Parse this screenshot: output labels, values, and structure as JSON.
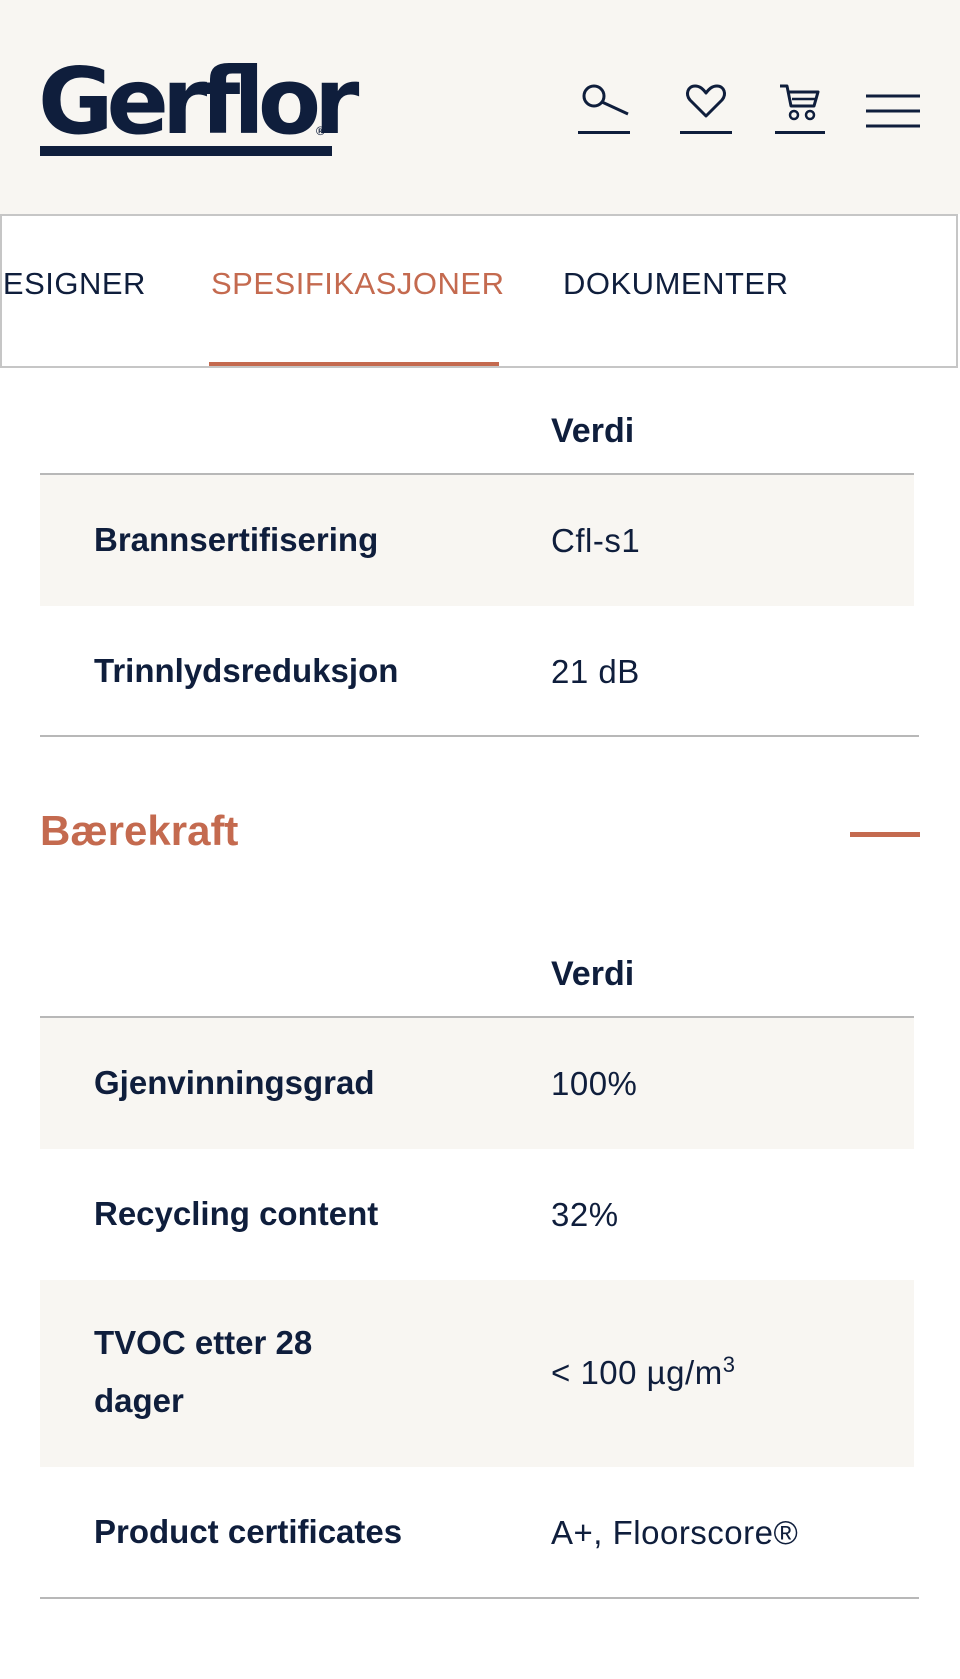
{
  "header": {
    "logo_text": "Gerflor",
    "logo_reg": "®",
    "icons": [
      "search-icon",
      "heart-icon",
      "cart-icon",
      "menu-icon"
    ]
  },
  "tabs": [
    {
      "label": "DESIGNER"
    },
    {
      "label": "SPESIFIKASJONER",
      "active": true
    },
    {
      "label": "DOKUMENTER"
    }
  ],
  "table1": {
    "header": "Verdi",
    "rows": [
      {
        "label": "Brannsertifisering",
        "value": "Cfl-s1"
      },
      {
        "label": "Trinnlydsreduksjon",
        "value": "21 dB"
      }
    ]
  },
  "section": {
    "title": "Bærekraft",
    "state": "expanded"
  },
  "table2": {
    "header": "Verdi",
    "rows": [
      {
        "label": "Gjenvinningsgrad",
        "value": "100%"
      },
      {
        "label": "Recycling content",
        "value": "32%"
      },
      {
        "label": "TVOC etter 28 dager",
        "value": "< 100 µg/m",
        "value_sup": "3"
      },
      {
        "label": "Product certificates",
        "value": "A+, Floorscore®"
      }
    ]
  },
  "colors": {
    "navy": "#0f1e3c",
    "accent": "#c46a4f",
    "header_bg": "#f8f6f2",
    "row_shade": "#f8f6f2"
  }
}
